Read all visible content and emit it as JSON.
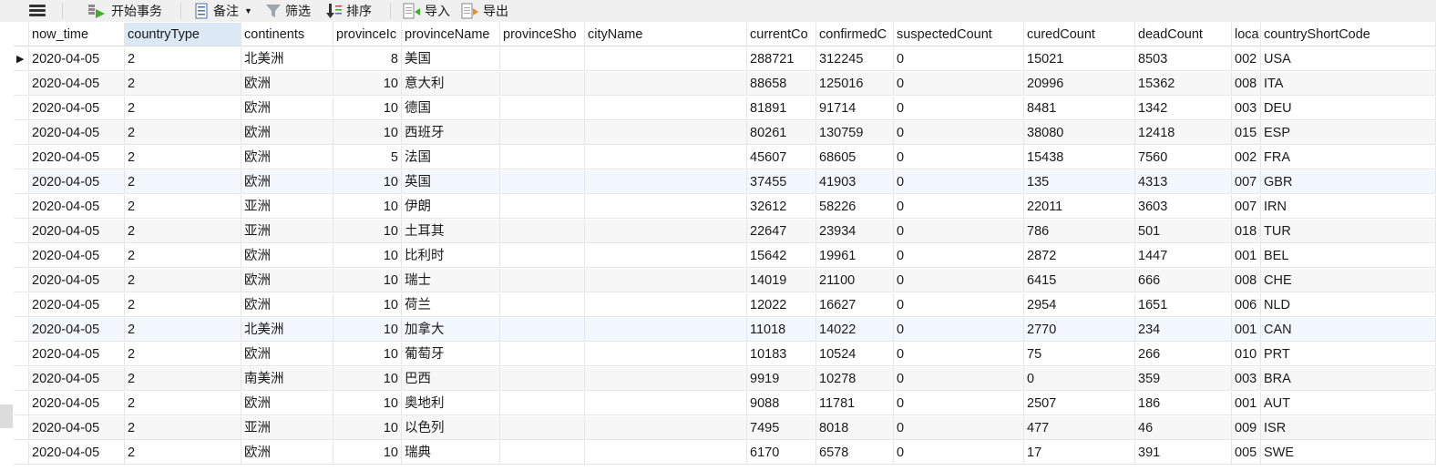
{
  "toolbar": {
    "menu_icon": "hamburger-menu-icon",
    "begin_transaction": "开始事务",
    "note": "备注",
    "filter": "筛选",
    "sort": "排序",
    "import": "导入",
    "export": "导出"
  },
  "columns": [
    "now_time",
    "countryType",
    "continents",
    "provinceId",
    "provinceName",
    "provinceSho",
    "cityName",
    "currentCo",
    "confirmedC",
    "suspectedCount",
    "curedCount",
    "deadCount",
    "loca",
    "countryShortCode"
  ],
  "column_headers_visible": [
    "now_time",
    "countryType",
    "continents",
    "provinceIc",
    "provinceName",
    "provinceSho",
    "cityName",
    "currentCo",
    "confirmedC",
    "suspectedCount",
    "curedCount",
    "deadCount",
    "loca",
    "countryShortCode"
  ],
  "selected_column": "countryType",
  "current_row_indicator": "▶",
  "rows": [
    [
      "2020-04-05",
      "2",
      "北美洲",
      "8",
      "美国",
      "",
      "",
      "288721",
      "312245",
      "0",
      "15021",
      "8503",
      "002",
      "USA"
    ],
    [
      "2020-04-05",
      "2",
      "欧洲",
      "10",
      "意大利",
      "",
      "",
      "88658",
      "125016",
      "0",
      "20996",
      "15362",
      "008",
      "ITA"
    ],
    [
      "2020-04-05",
      "2",
      "欧洲",
      "10",
      "德国",
      "",
      "",
      "81891",
      "91714",
      "0",
      "8481",
      "1342",
      "003",
      "DEU"
    ],
    [
      "2020-04-05",
      "2",
      "欧洲",
      "10",
      "西班牙",
      "",
      "",
      "80261",
      "130759",
      "0",
      "38080",
      "12418",
      "015",
      "ESP"
    ],
    [
      "2020-04-05",
      "2",
      "欧洲",
      "5",
      "法国",
      "",
      "",
      "45607",
      "68605",
      "0",
      "15438",
      "7560",
      "002",
      "FRA"
    ],
    [
      "2020-04-05",
      "2",
      "欧洲",
      "10",
      "英国",
      "",
      "",
      "37455",
      "41903",
      "0",
      "135",
      "4313",
      "007",
      "GBR"
    ],
    [
      "2020-04-05",
      "2",
      "亚洲",
      "10",
      "伊朗",
      "",
      "",
      "32612",
      "58226",
      "0",
      "22011",
      "3603",
      "007",
      "IRN"
    ],
    [
      "2020-04-05",
      "2",
      "亚洲",
      "10",
      "土耳其",
      "",
      "",
      "22647",
      "23934",
      "0",
      "786",
      "501",
      "018",
      "TUR"
    ],
    [
      "2020-04-05",
      "2",
      "欧洲",
      "10",
      "比利时",
      "",
      "",
      "15642",
      "19961",
      "0",
      "2872",
      "1447",
      "001",
      "BEL"
    ],
    [
      "2020-04-05",
      "2",
      "欧洲",
      "10",
      "瑞士",
      "",
      "",
      "14019",
      "21100",
      "0",
      "6415",
      "666",
      "008",
      "CHE"
    ],
    [
      "2020-04-05",
      "2",
      "欧洲",
      "10",
      "荷兰",
      "",
      "",
      "12022",
      "16627",
      "0",
      "2954",
      "1651",
      "006",
      "NLD"
    ],
    [
      "2020-04-05",
      "2",
      "北美洲",
      "10",
      "加拿大",
      "",
      "",
      "11018",
      "14022",
      "0",
      "2770",
      "234",
      "001",
      "CAN"
    ],
    [
      "2020-04-05",
      "2",
      "欧洲",
      "10",
      "葡萄牙",
      "",
      "",
      "10183",
      "10524",
      "0",
      "75",
      "266",
      "010",
      "PRT"
    ],
    [
      "2020-04-05",
      "2",
      "南美洲",
      "10",
      "巴西",
      "",
      "",
      "9919",
      "10278",
      "0",
      "0",
      "359",
      "003",
      "BRA"
    ],
    [
      "2020-04-05",
      "2",
      "欧洲",
      "10",
      "奥地利",
      "",
      "",
      "9088",
      "11781",
      "0",
      "2507",
      "186",
      "001",
      "AUT"
    ],
    [
      "2020-04-05",
      "2",
      "亚洲",
      "10",
      "以色列",
      "",
      "",
      "7495",
      "8018",
      "0",
      "477",
      "46",
      "009",
      "ISR"
    ],
    [
      "2020-04-05",
      "2",
      "欧洲",
      "10",
      "瑞典",
      "",
      "",
      "6170",
      "6578",
      "0",
      "17",
      "391",
      "005",
      "SWE"
    ]
  ],
  "highlight_rows": [
    5,
    11
  ],
  "colors": {
    "row_alt": "#f7f7f7",
    "row_highlight": "#f2f8fd",
    "header_selected": "#dbe8f5",
    "grid_line": "#e6e6e6",
    "toolbar_bg": "#f0f0f0"
  }
}
